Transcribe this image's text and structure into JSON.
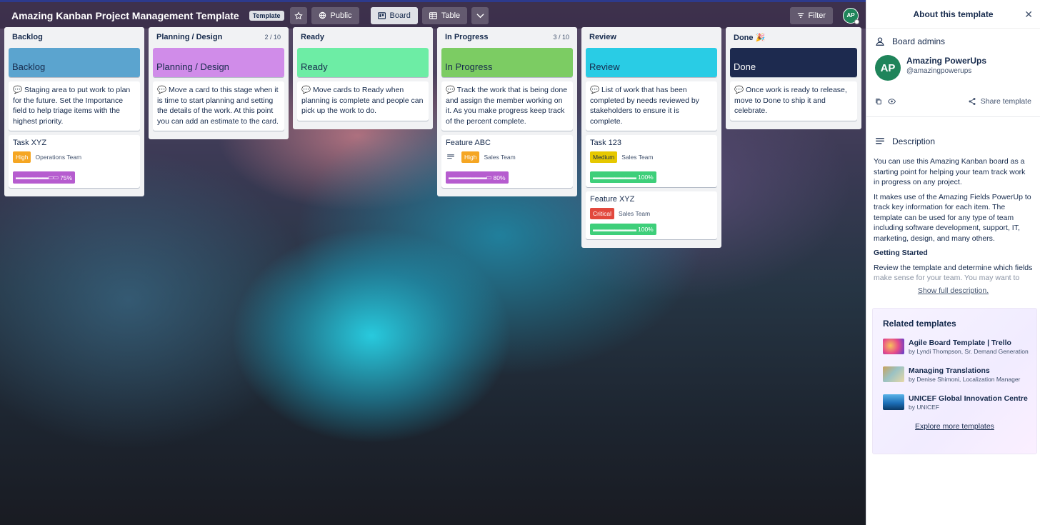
{
  "board": {
    "title": "Amazing Kanban Project Management Template",
    "template_badge": "Template",
    "public_label": "Public",
    "board_label": "Board",
    "table_label": "Table",
    "filter_label": "Filter",
    "user_initials": "AP"
  },
  "lists": [
    {
      "title": "Backlog",
      "count": "",
      "cover": {
        "label": "Backlog",
        "color": "#5ba4cf"
      },
      "desc": "💬 Staging area to put work to plan for the future. Set the Importance field to help triage items with the highest priority.",
      "cards": [
        {
          "title": "Task XYZ",
          "priority": "High",
          "team": "Operations Team",
          "progress": "75%"
        }
      ]
    },
    {
      "title": "Planning / Design",
      "count": "2 / 10",
      "cover": {
        "label": "Planning / Design",
        "color": "#d08ce9"
      },
      "desc": "💬 Move a card to this stage when it is time to start planning and setting the details of the work. At this point you can add an estimate to the card.",
      "cards": []
    },
    {
      "title": "Ready",
      "count": "",
      "cover": {
        "label": "Ready",
        "color": "#6deda5"
      },
      "desc": "💬 Move cards to Ready when planning is complete and people can pick up the work to do.",
      "cards": []
    },
    {
      "title": "In Progress",
      "count": "3 / 10",
      "cover": {
        "label": "In Progress",
        "color": "#7ccc63"
      },
      "desc": "💬 Track the work that is being done and assign the member working on it. As you make progress keep track of the percent complete.",
      "cards": [
        {
          "title": "Feature ABC",
          "priority": "High",
          "team": "Sales Team",
          "progress": "80%"
        }
      ]
    },
    {
      "title": "Review",
      "count": "",
      "cover": {
        "label": "Review",
        "color": "#29cce5"
      },
      "desc": "💬 List of work that has been completed by needs reviewed by stakeholders to ensure it is complete.",
      "cards": [
        {
          "title": "Task 123",
          "priority": "Medium",
          "team": "Sales Team",
          "progress": "100%"
        },
        {
          "title": "Feature XYZ",
          "priority": "Critical",
          "team": "Sales Team",
          "progress": "100%"
        }
      ]
    },
    {
      "title": "Done 🎉",
      "count": "",
      "cover": {
        "label": "Done",
        "color": "#1d2a4f"
      },
      "desc": "💬 Once work is ready to release, move to Done to ship it and celebrate.",
      "cards": []
    }
  ],
  "panel": {
    "title": "About this template",
    "admins_heading": "Board admins",
    "admin_initials": "AP",
    "admin_name": "Amazing PowerUps",
    "admin_handle": "@amazingpowerups",
    "share_label": "Share template",
    "description_heading": "Description",
    "desc_p1": "You can use this Amazing Kanban board as a starting point for helping your team track work in progress on any project.",
    "desc_p2": "It makes use of the Amazing Fields PowerUp to track key information for each item. The template can be used for any type of team including software development, support, IT, marketing, design, and many others.",
    "desc_h": "Getting Started",
    "desc_p3a": "Review the template and determine which fields",
    "desc_p3b": "make sense for your team. You may want to",
    "show_full": "Show full description.",
    "related_heading": "Related templates",
    "related": [
      {
        "name": "Agile Board Template | Trello",
        "by": "by Lyndi Thompson, Sr. Demand Generation"
      },
      {
        "name": "Managing Translations",
        "by": "by Denise Shimoni, Localization Manager"
      },
      {
        "name": "UNICEF Global Innovation Centre",
        "by": "by UNICEF"
      }
    ],
    "explore": "Explore more templates"
  }
}
